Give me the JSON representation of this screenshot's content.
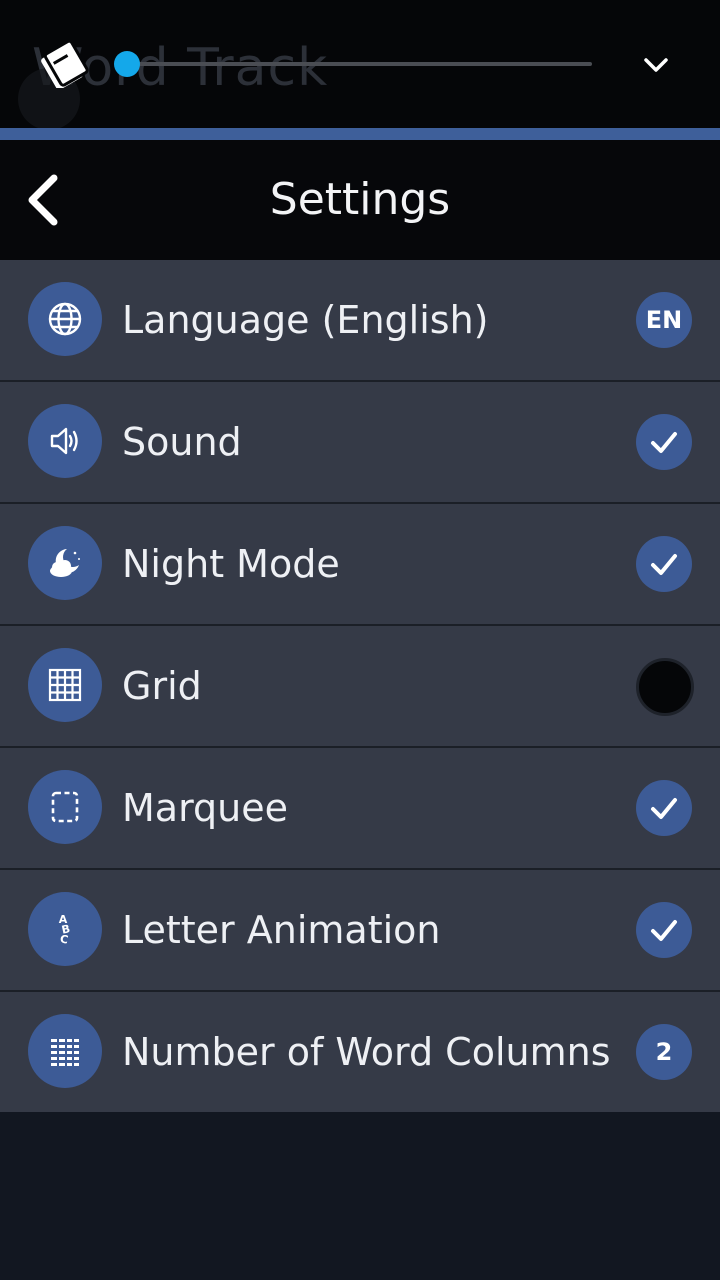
{
  "topbar": {
    "ghost_title": "Word Track",
    "logo_icon": "cards-icon",
    "dropdown_icon": "chevron-down-icon"
  },
  "header": {
    "title": "Settings",
    "back_icon": "chevron-left-icon"
  },
  "settings": [
    {
      "label": "Language (English)",
      "icon": "globe-icon",
      "status_text": "EN",
      "status": "value"
    },
    {
      "label": "Sound",
      "icon": "speaker-icon",
      "status_text": "",
      "status": "on"
    },
    {
      "label": "Night Mode",
      "icon": "moon-cloud-icon",
      "status_text": "",
      "status": "on"
    },
    {
      "label": "Grid",
      "icon": "grid-icon",
      "status_text": "",
      "status": "off"
    },
    {
      "label": "Marquee",
      "icon": "marquee-icon",
      "status_text": "",
      "status": "on"
    },
    {
      "label": "Letter Animation",
      "icon": "abc-icon",
      "status_text": "",
      "status": "on"
    },
    {
      "label": "Number of Word Columns",
      "icon": "columns-icon",
      "status_text": "2",
      "status": "value"
    }
  ],
  "colors": {
    "accent": "#3d5b96",
    "row_bg": "#353a47",
    "slider_thumb": "#14a8ea"
  }
}
